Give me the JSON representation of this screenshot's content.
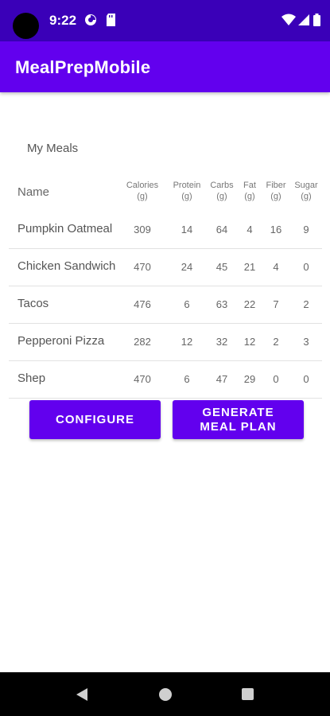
{
  "status": {
    "time": "9:22"
  },
  "app": {
    "title": "MealPrepMobile"
  },
  "section": {
    "title": "My Meals"
  },
  "table": {
    "headers": {
      "name": "Name",
      "calories": [
        "Calories",
        "(g)"
      ],
      "protein": [
        "Protein",
        "(g)"
      ],
      "carbs": [
        "Carbs",
        "(g)"
      ],
      "fat": [
        "Fat",
        "(g)"
      ],
      "fiber": [
        "Fiber",
        "(g)"
      ],
      "sugar": [
        "Sugar",
        "(g)"
      ]
    },
    "rows": [
      {
        "name": "Pumpkin Oatmeal",
        "calories": "309",
        "protein": "14",
        "carbs": "64",
        "fat": "4",
        "fiber": "16",
        "sugar": "9"
      },
      {
        "name": "Chicken Sandwich",
        "calories": "470",
        "protein": "24",
        "carbs": "45",
        "fat": "21",
        "fiber": "4",
        "sugar": "0"
      },
      {
        "name": "Tacos",
        "calories": "476",
        "protein": "6",
        "carbs": "63",
        "fat": "22",
        "fiber": "7",
        "sugar": "2"
      },
      {
        "name": "Pepperoni Pizza",
        "calories": "282",
        "protein": "12",
        "carbs": "32",
        "fat": "12",
        "fiber": "2",
        "sugar": "3"
      },
      {
        "name": "Shep",
        "calories": "470",
        "protein": "6",
        "carbs": "47",
        "fat": "29",
        "fiber": "0",
        "sugar": "0"
      }
    ]
  },
  "buttons": {
    "configure": "CONFIGURE",
    "generate_line1": "GENERATE",
    "generate_line2": "MEAL PLAN"
  },
  "icons": {
    "status": [
      "data-saver-icon",
      "sd-card-icon",
      "wifi-icon",
      "signal-icon",
      "battery-icon"
    ],
    "nav": [
      "back-icon",
      "home-icon",
      "recents-icon"
    ]
  },
  "colors": {
    "status_bar": "#3a00b8",
    "primary": "#6200ee",
    "nav_bar": "#000000"
  }
}
